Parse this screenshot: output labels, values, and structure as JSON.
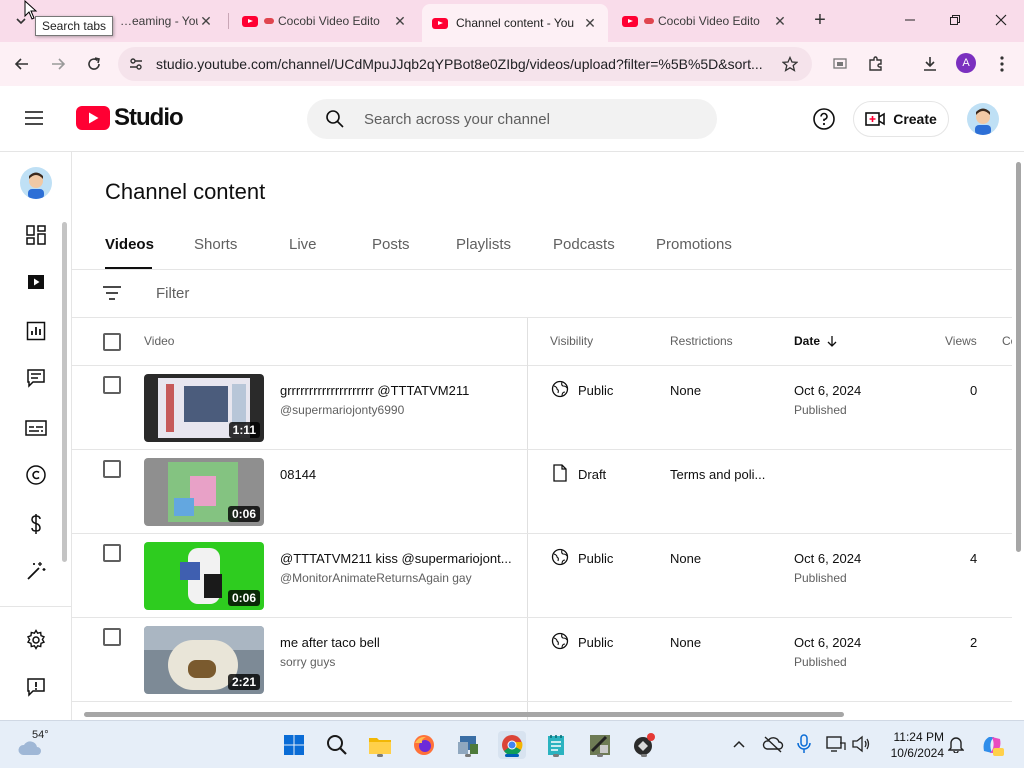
{
  "browser": {
    "tabs": [
      {
        "label": "…eaming - YouTu"
      },
      {
        "label": "Cocobi Video Edito"
      },
      {
        "label": "Channel content - You"
      },
      {
        "label": "Cocobi Video Edito"
      }
    ],
    "tooltip": "Search tabs",
    "url": "studio.youtube.com/channel/UCdMpuJJqb2qYPBot8e0ZIbg/videos/upload?filter=%5B%5D&sort...",
    "profile_initial": "A"
  },
  "studio": {
    "logo_text": "Studio",
    "search_placeholder": "Search across your channel",
    "create_label": "Create"
  },
  "main": {
    "title": "Channel content",
    "tabs": [
      {
        "label": "Videos",
        "active": true
      },
      {
        "label": "Shorts"
      },
      {
        "label": "Live"
      },
      {
        "label": "Posts"
      },
      {
        "label": "Playlists"
      },
      {
        "label": "Podcasts"
      },
      {
        "label": "Promotions"
      }
    ],
    "filter_placeholder": "Filter",
    "columns": {
      "video": "Video",
      "visibility": "Visibility",
      "restrictions": "Restrictions",
      "date": "Date",
      "views": "Views",
      "comments": "Co"
    },
    "rows": [
      {
        "title": "grrrrrrrrrrrrrrrrrrrr @TTTATVM211",
        "subtitle": "@supermariojonty6990",
        "duration": "1:11",
        "visibility": "Public",
        "restrictions": "None",
        "date": "Oct 6, 2024",
        "date_status": "Published",
        "views": "0"
      },
      {
        "title": "08144",
        "subtitle": "",
        "duration": "0:06",
        "visibility": "Draft",
        "restrictions": "Terms and poli...",
        "date": "",
        "date_status": "",
        "views": ""
      },
      {
        "title": "@TTTATVM211 kiss @supermariojont...",
        "subtitle": "@MonitorAnimateReturnsAgain gay",
        "duration": "0:06",
        "visibility": "Public",
        "restrictions": "None",
        "date": "Oct 6, 2024",
        "date_status": "Published",
        "views": "4"
      },
      {
        "title": "me after taco bell",
        "subtitle": "sorry guys",
        "duration": "2:21",
        "visibility": "Public",
        "restrictions": "None",
        "date": "Oct 6, 2024",
        "date_status": "Published",
        "views": "2"
      }
    ]
  },
  "taskbar": {
    "weather_temp": "54°",
    "time": "11:24 PM",
    "date": "10/6/2024"
  },
  "colors": {
    "youtube_red": "#ff0033",
    "tabstrip_bg": "#f9dcea",
    "accent_blue": "#065fd4"
  }
}
